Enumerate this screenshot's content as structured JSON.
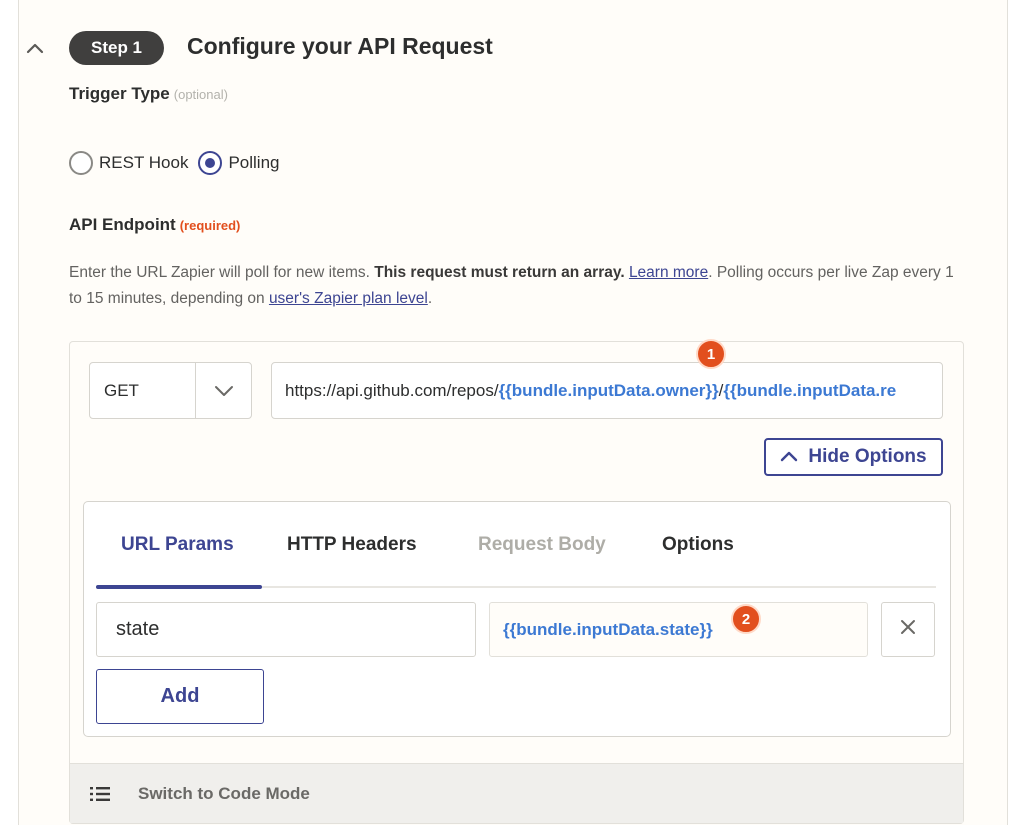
{
  "step": {
    "badge": "Step 1",
    "title": "Configure your API Request"
  },
  "trigger": {
    "label": "Trigger Type",
    "hint": "(optional)",
    "options": [
      {
        "label": "REST Hook",
        "selected": false
      },
      {
        "label": "Polling",
        "selected": true
      }
    ]
  },
  "endpoint": {
    "label": "API Endpoint",
    "hint": "(required)",
    "desc_1": "Enter the URL Zapier will poll for new items.",
    "desc_bold": "This request must return an array.",
    "desc_link_1": "Learn more",
    "desc_2": ". Polling occurs per live Zap every 1 to 15 minutes, depending on",
    "desc_link_2": "user's Zapier plan level",
    "desc_3": "."
  },
  "request": {
    "method": "GET",
    "url_prefix": "https://api.github.com/repos/",
    "url_token_1": "{{bundle.inputData.owner}}",
    "url_sep": "/",
    "url_token_2": "{{bundle.inputData.re",
    "marker_1": "1",
    "hide_options_label": "Hide Options"
  },
  "tabs": [
    {
      "label": "URL Params",
      "state": "active"
    },
    {
      "label": "HTTP Headers",
      "state": "normal"
    },
    {
      "label": "Request Body",
      "state": "disabled"
    },
    {
      "label": "Options",
      "state": "normal"
    }
  ],
  "params": {
    "key": "state",
    "value": "{{bundle.inputData.state}}",
    "marker_2": "2",
    "add_label": "Add"
  },
  "code_mode": {
    "label": "Switch to Code Mode"
  },
  "colors": {
    "accent": "#3d4592",
    "token": "#3c79d3",
    "required": "#e24f1e",
    "badge_bg": "#403f3e"
  },
  "icons": [
    "chevron-up-icon",
    "chevron-down-icon",
    "close-icon",
    "list-icon"
  ]
}
